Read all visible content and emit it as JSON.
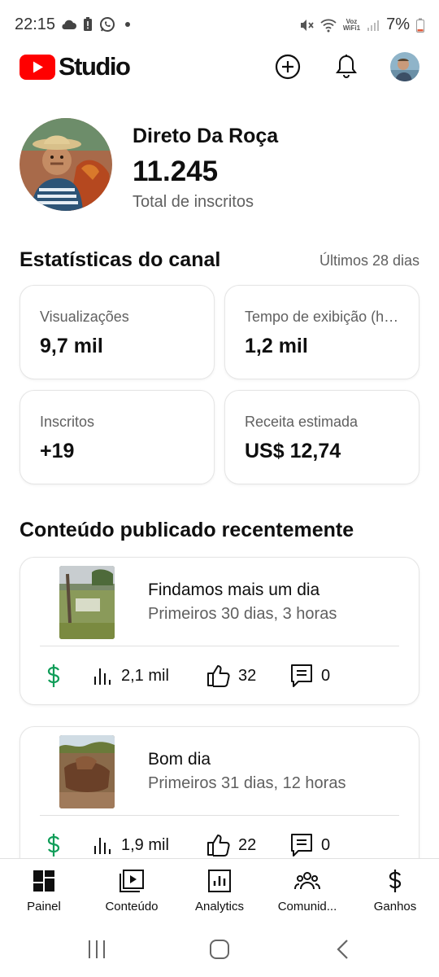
{
  "status_bar": {
    "time": "22:15",
    "battery": "7%",
    "network_label_top": "Voz",
    "network_label_bottom": "WiFi1",
    "icons": [
      "cloud-icon",
      "battery-alert-icon",
      "whatsapp-icon",
      "dot-icon",
      "mute-icon",
      "wifi-icon",
      "signal-icon",
      "battery-icon"
    ]
  },
  "app_bar": {
    "logo_text": "Studio",
    "brand_color": "#ff0000",
    "icons": [
      "create-icon",
      "notifications-icon",
      "account-avatar"
    ]
  },
  "channel": {
    "name": "Direto Da Roça",
    "subscriber_count": "11.245",
    "subscriber_label": "Total de inscritos"
  },
  "stats": {
    "title": "Estatísticas do canal",
    "period": "Últimos 28 dias",
    "cards": [
      {
        "label": "Visualizações",
        "value": "9,7 mil"
      },
      {
        "label": "Tempo de exibição (horas)",
        "value": "1,2 mil"
      },
      {
        "label": "Inscritos",
        "value": "+19"
      },
      {
        "label": "Receita estimada",
        "value": "US$ 12,74"
      }
    ]
  },
  "recent": {
    "title": "Conteúdo publicado recentemente",
    "videos": [
      {
        "title": "Findamos mais um dia",
        "subtitle": "Primeiros 30 dias, 3 horas",
        "views": "2,1 mil",
        "likes": "32",
        "comments": "0"
      },
      {
        "title": "Bom dia",
        "subtitle": "Primeiros 31 dias, 12 horas",
        "views": "1,9 mil",
        "likes": "22",
        "comments": "0"
      }
    ]
  },
  "bottom_nav": [
    {
      "label": "Painel",
      "icon": "dashboard-icon"
    },
    {
      "label": "Conteúdo",
      "icon": "content-icon"
    },
    {
      "label": "Analytics",
      "icon": "analytics-icon"
    },
    {
      "label": "Comunid...",
      "icon": "community-icon"
    },
    {
      "label": "Ganhos",
      "icon": "earn-icon"
    }
  ],
  "colors": {
    "monetization_green": "#0f9d58",
    "secondary_text": "#606060"
  }
}
